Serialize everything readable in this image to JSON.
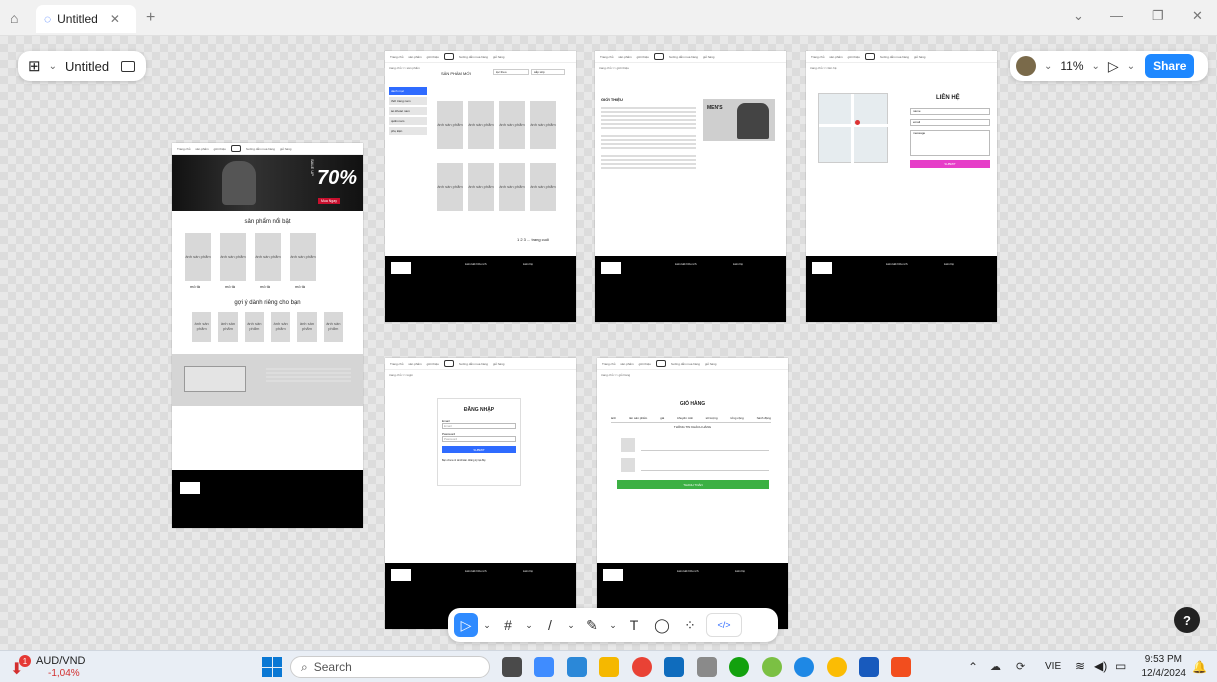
{
  "browser": {
    "tab_title": "Untitled",
    "new_tab": "+",
    "home_glyph": "⌂",
    "close_glyph": "✕",
    "chevron_glyph": "⌄",
    "minimize_glyph": "—",
    "restore_glyph": "❐"
  },
  "figma": {
    "file_name": "Untitled",
    "zoom": "11%",
    "share_label": "Share",
    "help_label": "?",
    "toolbar": {
      "move": "▷",
      "frame": "#",
      "line": "/",
      "pen": "✎",
      "text": "T",
      "comment": "◯",
      "actions": "⁘",
      "dev": "</>"
    }
  },
  "frames": {
    "nav_items": [
      "Trang chủ",
      "sản phẩm",
      "giới thiệu",
      "liên hệ",
      "hướng dẫn mua hàng",
      "tài khoản",
      "giỏ hàng"
    ],
    "home": {
      "sale_text": "70%",
      "sale_small": "SALE UP",
      "buy_btn": "Mua Ngay",
      "featured_title": "sản phẩm nổi bật",
      "featured_items": [
        "ảnh sản phẩm",
        "ảnh sản phẩm",
        "ảnh sản phẩm",
        "ảnh sản phẩm"
      ],
      "desc": "mô tả",
      "suggest_title": "gợi ý dành riêng cho bạn",
      "suggest_items": [
        "ảnh sản phẩm",
        "ảnh sản phẩm",
        "ảnh sản phẩm",
        "ảnh sản phẩm",
        "ảnh sản phẩm",
        "ảnh sản phẩm"
      ]
    },
    "products": {
      "breadcrumb": "trang chủ >> sản phẩm",
      "title": "SẢN PHẨM MỚI",
      "filter1": "lọc theo",
      "filter2": "sắp xếp",
      "sidebar": [
        "danh mục",
        "thời trang nam",
        "áo khoác nam",
        "quần nam",
        "phụ kiện"
      ],
      "items": [
        "ảnh sản phẩm",
        "ảnh sản phẩm",
        "ảnh sản phẩm",
        "ảnh sản phẩm",
        "ảnh sản phẩm",
        "ảnh sản phẩm",
        "ảnh sản phẩm",
        "ảnh sản phẩm"
      ],
      "desc": "mô tả",
      "pagination": "1  2  3 ... trang cuối"
    },
    "about": {
      "breadcrumb": "trang chủ >> giới thiệu",
      "heading": "GIỚI THIỆU",
      "brand": "MEN'S"
    },
    "contact": {
      "breadcrumb": "trang chủ >> liên hệ",
      "title": "LIÊN HỆ",
      "name": "name",
      "email": "email",
      "message": "message",
      "submit": "SUBMIT"
    },
    "login": {
      "breadcrumb": "trang chủ >> login",
      "title": "ĐĂNG NHẬP",
      "email_label": "Email",
      "email_ph": "Email",
      "password_label": "Password",
      "password_ph": "Password",
      "submit": "SUBMIT",
      "register": "Bạn chưa có tài khoản. Đăng ký tại đây"
    },
    "cart": {
      "breadcrumb": "trang chủ >> giỏ hàng",
      "title": "GIỎ HÀNG",
      "columns": [
        "ảnh",
        "tên sản phẩm",
        "giá",
        "khuyến mãi",
        "số lượng",
        "tổng cộng",
        "hành động"
      ],
      "customer": "THÔNG TIN KHÁCH HÀNG",
      "pay_btn": "THANH TOÁN"
    },
    "footer": {
      "contact_title": "Liên hệ",
      "links_title": "Liên kết hữu ích"
    }
  },
  "taskbar": {
    "ticker_name": "AUD/VND",
    "ticker_change": "-1,04%",
    "ticker_badge": "1",
    "search_placeholder": "Search",
    "lang": "VIE",
    "time": "9:53 PM",
    "date": "12/4/2024"
  },
  "colors": {
    "accent": "#2f6bff",
    "share": "#1e88ff",
    "pink": "#e63ec8",
    "green": "#3cb043",
    "sale_red": "#c8102e"
  }
}
